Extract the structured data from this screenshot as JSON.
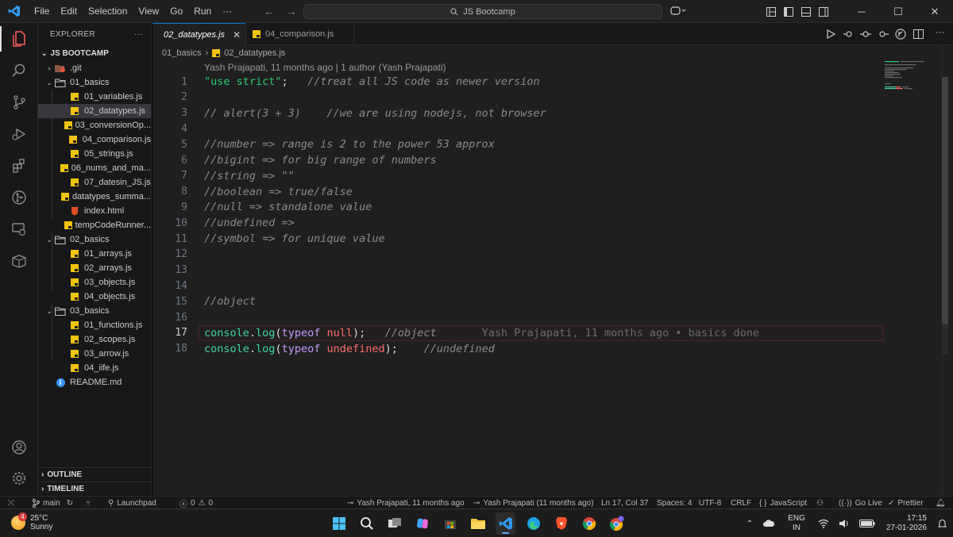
{
  "menu": [
    "File",
    "Edit",
    "Selection",
    "View",
    "Go",
    "Run",
    "···"
  ],
  "search": {
    "text": "JS Bootcamp"
  },
  "explorer": {
    "title": "EXPLORER",
    "more": "···",
    "root": "JS BOOTCAMP",
    "items": [
      {
        "label": ".git",
        "kind": "folder-git",
        "depth": 1,
        "chev": "›"
      },
      {
        "label": "01_basics",
        "kind": "folder-open",
        "depth": 1,
        "chev": "⌄"
      },
      {
        "label": "01_variables.js",
        "kind": "js",
        "depth": 2
      },
      {
        "label": "02_datatypes.js",
        "kind": "js",
        "depth": 2,
        "selected": true
      },
      {
        "label": "03_conversionOp...",
        "kind": "js",
        "depth": 2
      },
      {
        "label": "04_comparison.js",
        "kind": "js",
        "depth": 2
      },
      {
        "label": "05_strings.js",
        "kind": "js",
        "depth": 2
      },
      {
        "label": "06_nums_and_ma...",
        "kind": "js",
        "depth": 2
      },
      {
        "label": "07_datesin_JS.js",
        "kind": "js",
        "depth": 2
      },
      {
        "label": "datatypes_summa...",
        "kind": "js",
        "depth": 2
      },
      {
        "label": "index.html",
        "kind": "html",
        "depth": 2
      },
      {
        "label": "tempCodeRunner...",
        "kind": "js",
        "depth": 2
      },
      {
        "label": "02_basics",
        "kind": "folder-open",
        "depth": 1,
        "chev": "⌄"
      },
      {
        "label": "01_arrays.js",
        "kind": "js",
        "depth": 2
      },
      {
        "label": "02_arrays.js",
        "kind": "js",
        "depth": 2
      },
      {
        "label": "03_objects.js",
        "kind": "js",
        "depth": 2
      },
      {
        "label": "04_objects.js",
        "kind": "js",
        "depth": 2
      },
      {
        "label": "03_basics",
        "kind": "folder-open",
        "depth": 1,
        "chev": "⌄"
      },
      {
        "label": "01_functions.js",
        "kind": "js",
        "depth": 2
      },
      {
        "label": "02_scopes.js",
        "kind": "js",
        "depth": 2
      },
      {
        "label": "03_arrow.js",
        "kind": "js",
        "depth": 2
      },
      {
        "label": "04_iife.js",
        "kind": "js",
        "depth": 2
      },
      {
        "label": "README.md",
        "kind": "info",
        "depth": 1
      }
    ],
    "outline": "OUTLINE",
    "timeline": "TIMELINE"
  },
  "tabs": [
    {
      "label": "02_datatypes.js",
      "active": true,
      "close": "✕"
    },
    {
      "label": "04_comparison.js",
      "active": false
    }
  ],
  "breadcrumb": [
    "01_basics",
    "02_datatypes.js"
  ],
  "blame_header": "Yash Prajapati, 11 months ago | 1 author (Yash Prajapati)",
  "code": [
    {
      "n": "1",
      "parts": [
        [
          "str",
          "\"use strict\""
        ],
        [
          "p",
          ";   "
        ],
        [
          "com",
          "//treat all JS code as newer version"
        ]
      ]
    },
    {
      "n": "2",
      "parts": []
    },
    {
      "n": "3",
      "parts": [
        [
          "com",
          "// alert(3 + 3)    //we are using nodejs, not browser"
        ]
      ]
    },
    {
      "n": "4",
      "parts": []
    },
    {
      "n": "5",
      "parts": [
        [
          "com",
          "//number => range is 2 to the power 53 approx"
        ]
      ]
    },
    {
      "n": "6",
      "parts": [
        [
          "com",
          "//bigint => for big range of numbers"
        ]
      ]
    },
    {
      "n": "7",
      "parts": [
        [
          "com",
          "//string => \"\""
        ]
      ]
    },
    {
      "n": "8",
      "parts": [
        [
          "com",
          "//boolean => true/false"
        ]
      ]
    },
    {
      "n": "9",
      "parts": [
        [
          "com",
          "//null => standalone value"
        ]
      ]
    },
    {
      "n": "10",
      "parts": [
        [
          "com",
          "//undefined =>"
        ]
      ]
    },
    {
      "n": "11",
      "parts": [
        [
          "com",
          "//symbol => for unique value"
        ]
      ]
    },
    {
      "n": "12",
      "parts": []
    },
    {
      "n": "13",
      "parts": []
    },
    {
      "n": "14",
      "parts": []
    },
    {
      "n": "15",
      "parts": [
        [
          "com",
          "//object"
        ]
      ]
    },
    {
      "n": "16",
      "parts": []
    },
    {
      "n": "17",
      "current": true,
      "parts": [
        [
          "fn",
          "console"
        ],
        [
          "p",
          "."
        ],
        [
          "fn",
          "log"
        ],
        [
          "p",
          "("
        ],
        [
          "kw",
          "typeof"
        ],
        [
          "p",
          " "
        ],
        [
          "val",
          "null"
        ],
        [
          "p",
          ");   "
        ],
        [
          "com",
          "//object"
        ],
        [
          "blame",
          "       Yash Prajapati, 11 months ago • basics done"
        ]
      ]
    },
    {
      "n": "18",
      "parts": [
        [
          "fn",
          "console"
        ],
        [
          "p",
          "."
        ],
        [
          "fn",
          "log"
        ],
        [
          "p",
          "("
        ],
        [
          "kw",
          "typeof"
        ],
        [
          "p",
          " "
        ],
        [
          "val",
          "undefined"
        ],
        [
          "p",
          ");    "
        ],
        [
          "com",
          "//undefined"
        ]
      ]
    }
  ],
  "status": {
    "branch": "main",
    "launchpad": "Launchpad",
    "problems": "0",
    "warnings": "0",
    "blame1": "Yash Prajapati, 11 months ago",
    "blame2": "Yash Prajapati (11 months ago)",
    "position": "Ln 17, Col 37",
    "spaces": "Spaces: 4",
    "encoding": "UTF-8",
    "eol": "CRLF",
    "language": "JavaScript",
    "golive": "Go Live",
    "prettier": "Prettier"
  },
  "taskbar": {
    "temp": "25°C",
    "weather": "Sunny",
    "weather_badge": "4",
    "lang1": "ENG",
    "lang2": "IN",
    "time": "17:15",
    "date": "27-01-2026",
    "apps": [
      "windows-start",
      "search",
      "task-view",
      "copilot",
      "store",
      "file-explorer",
      "vscode",
      "edge",
      "brave",
      "chrome",
      "chrome-profile"
    ]
  },
  "colors": {
    "accent": "#0078d4",
    "string": "#2ecc71",
    "comment": "#8b8b8b",
    "function": "#3dd5a4",
    "keyword": "#c79bff",
    "value": "#ff6b6b"
  }
}
